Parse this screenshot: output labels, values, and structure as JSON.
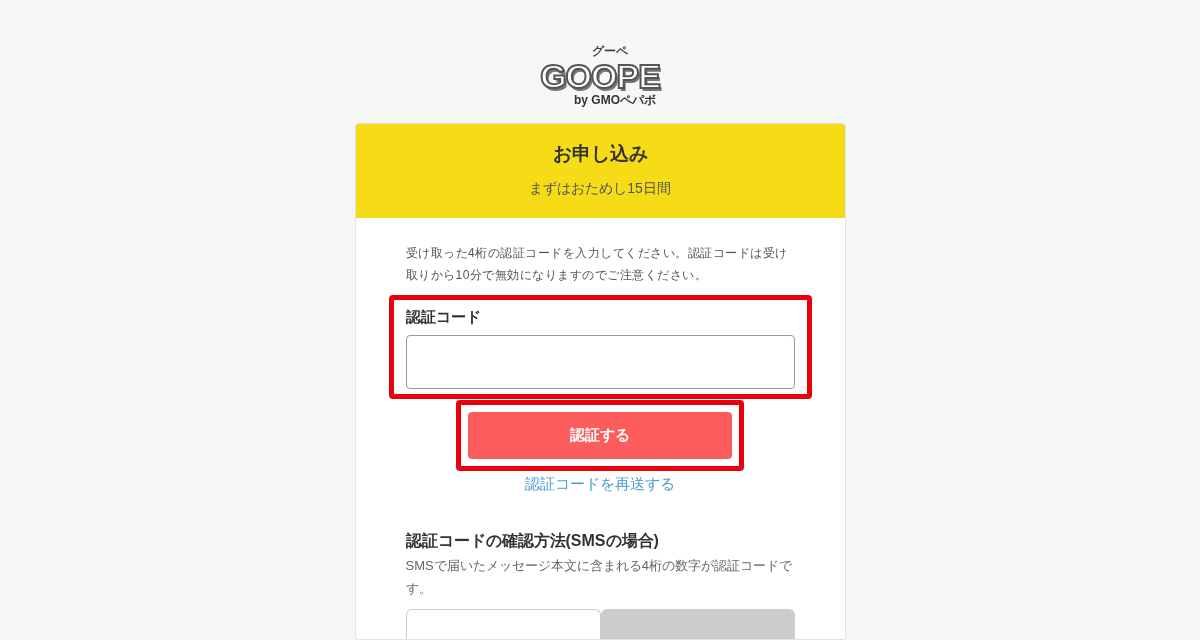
{
  "logo": {
    "kana": "グーペ",
    "wordmark": "GOOPE",
    "byline": "by GMOペパボ"
  },
  "header": {
    "title": "お申し込み",
    "subtitle": "まずはおためし15日間"
  },
  "intro": "受け取った4桁の認証コードを入力してください。認証コードは受け取りから10分で無効になりますのでご注意ください。",
  "code_field": {
    "label": "認証コード",
    "highlighted": true
  },
  "verify_button": {
    "label": "認証する",
    "highlighted": true
  },
  "resend_link": "認証コードを再送する",
  "sms_help": {
    "title": "認証コードの確認方法(SMSの場合)",
    "text": "SMSで届いたメッセージ本文に含まれる4桁の数字が認証コードです。"
  },
  "tabs": [
    {
      "selected": true
    },
    {
      "selected": false
    }
  ]
}
